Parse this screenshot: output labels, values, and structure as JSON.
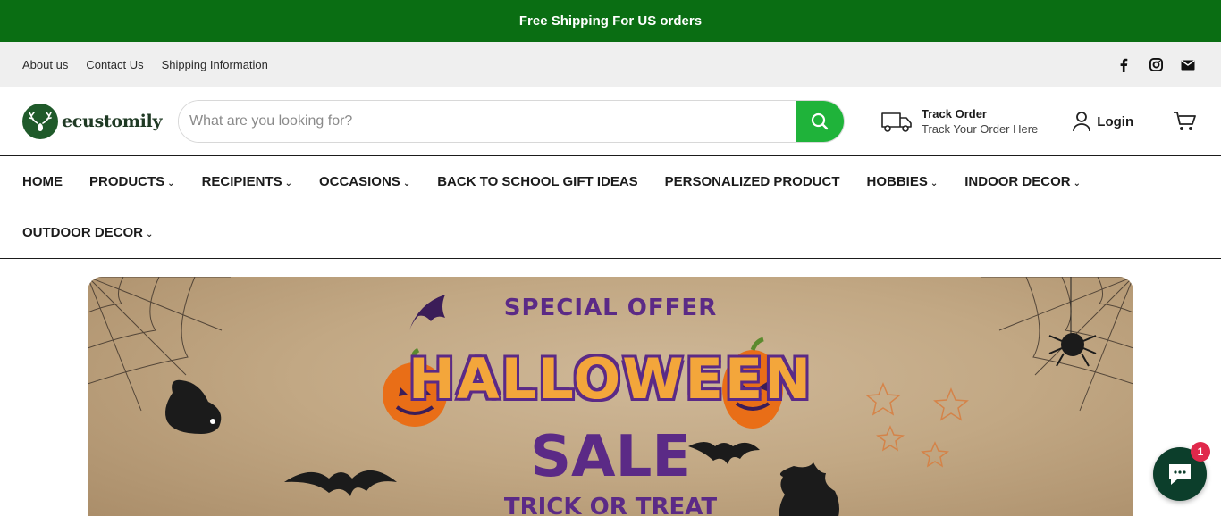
{
  "announcement": "Free Shipping For US orders",
  "utility_links": [
    "About us",
    "Contact Us",
    "Shipping Information"
  ],
  "social_icons": [
    "facebook-icon",
    "instagram-icon",
    "email-icon"
  ],
  "brand": "ecustomily",
  "search": {
    "placeholder": "What are you looking for?"
  },
  "track": {
    "title": "Track Order",
    "subtitle": "Track Your Order Here"
  },
  "login_label": "Login",
  "nav": {
    "row1": [
      {
        "label": "HOME",
        "dropdown": false
      },
      {
        "label": "PRODUCTS",
        "dropdown": true
      },
      {
        "label": "RECIPIENTS",
        "dropdown": true
      },
      {
        "label": "OCCASIONS",
        "dropdown": true
      },
      {
        "label": "BACK TO SCHOOL GIFT IDEAS",
        "dropdown": false
      },
      {
        "label": "PERSONALIZED PRODUCT",
        "dropdown": false
      },
      {
        "label": "HOBBIES",
        "dropdown": true
      },
      {
        "label": "INDOOR DECOR",
        "dropdown": true
      }
    ],
    "row2": [
      {
        "label": "OUTDOOR DECOR",
        "dropdown": true
      }
    ]
  },
  "hero": {
    "line1": "SPECIAL OFFER",
    "line2": "HALLOWEEN",
    "line3": "SALE",
    "line4": "TRICK OR TREAT"
  },
  "chat": {
    "badge": "1"
  },
  "colors": {
    "brand_green": "#0a6e13",
    "search_green": "#1fb33a",
    "halloween_purple": "#5b2a86",
    "halloween_orange": "#f3a63b"
  }
}
